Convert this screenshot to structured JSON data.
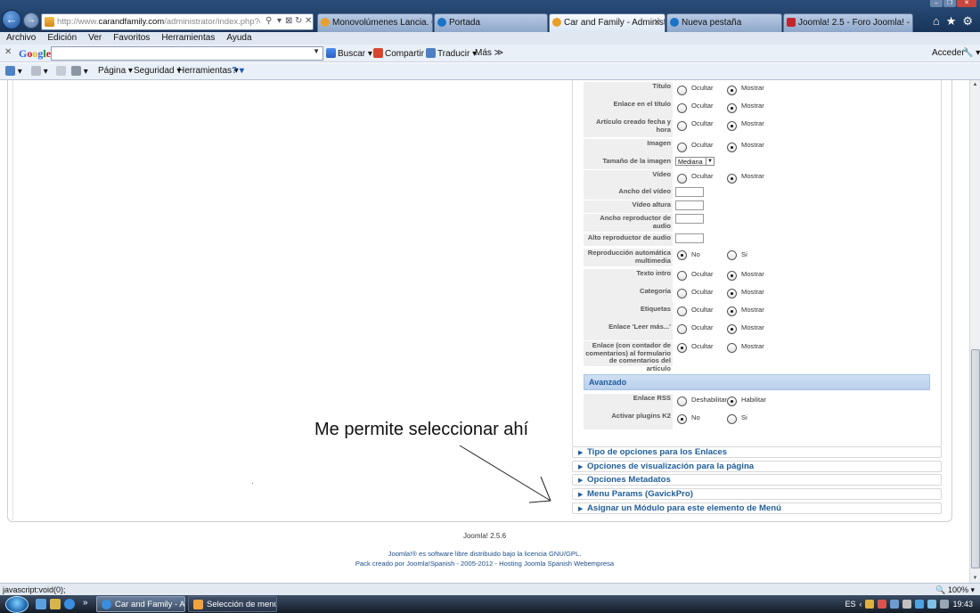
{
  "browser": {
    "url_prefix": "http://www.",
    "url_domain": "carandfamily.com",
    "url_path": "/administrator/index.php?option=co",
    "addr_controls": [
      "⚲",
      "▾",
      "⊠",
      "↻",
      "✕"
    ],
    "tabs": [
      {
        "label": "Monovolúmenes Lancia. Coch...",
        "icon_color": "#e8a02a",
        "active": false
      },
      {
        "label": "Portada",
        "icon_color": "#1a73c9",
        "active": false
      },
      {
        "label": "Car and Family - Administ...",
        "icon_color": "#e8a02a",
        "active": true
      },
      {
        "label": "Nueva pestaña",
        "icon_color": "#1a73c9",
        "active": false
      },
      {
        "label": "Joomla! 2.5 - Foro Joomla! - Se...",
        "icon_color": "#c1272d",
        "active": false
      }
    ],
    "tab_close": "✕",
    "window_buttons": [
      "–",
      "❐",
      "✕"
    ],
    "chrome_icons": {
      "home": "⌂",
      "favorites": "★",
      "tools": "⚙"
    },
    "menu": [
      "Archivo",
      "Edición",
      "Ver",
      "Favoritos",
      "Herramientas",
      "Ayuda"
    ],
    "google_bar": {
      "close": "✕",
      "logo": "Google",
      "search_value": "",
      "dropdown": "▼",
      "buscar": "Buscar ▾",
      "compartir": "Compartir",
      "traducir": "Traducir ▾",
      "mas": "Más ≫",
      "acceder": "Acceder",
      "wrench": "🔧 ▾"
    },
    "command_bar": {
      "pagina": "Página ▾",
      "seguridad": "Seguridad ▾",
      "herramientas": "Herramientas ▾",
      "help": "? ▾"
    },
    "status_text": "javascript:void(0);",
    "zoom": "🔍 100%  ▾"
  },
  "options": {
    "rows": [
      {
        "label": "Título",
        "opt1": "Ocultar",
        "opt2": "Mostrar",
        "selected": 2
      },
      {
        "label": "Enlace en el título",
        "opt1": "Ocultar",
        "opt2": "Mostrar",
        "selected": 2
      },
      {
        "label": "Artículo creado fecha y hora",
        "opt1": "Ocultar",
        "opt2": "Mostrar",
        "selected": 2
      },
      {
        "label": "Imagen",
        "opt1": "Ocultar",
        "opt2": "Mostrar",
        "selected": 2
      },
      {
        "label": "Tamaño de la imagen",
        "select_value": "Mediana"
      },
      {
        "label": "Vídeo",
        "opt1": "Ocultar",
        "opt2": "Mostrar",
        "selected": 2
      },
      {
        "label": "Ancho del vídeo",
        "input_value": ""
      },
      {
        "label": "Vídeo altura",
        "input_value": ""
      },
      {
        "label": "Ancho reproductor de audio",
        "input_value": ""
      },
      {
        "label": "Alto reproductor de audio",
        "input_value": ""
      },
      {
        "label": "Reproducción automática multimedia",
        "opt1": "No",
        "opt2": "Si",
        "selected": 1
      },
      {
        "label": "Texto intro",
        "opt1": "Ocultar",
        "opt2": "Mostrar",
        "selected": 2
      },
      {
        "label": "Categoría",
        "opt1": "Ocultar",
        "opt2": "Mostrar",
        "selected": 2
      },
      {
        "label": "Etiquetas",
        "opt1": "Ocultar",
        "opt2": "Mostrar",
        "selected": 2
      },
      {
        "label": "Enlace 'Leer más...'",
        "opt1": "Ocultar",
        "opt2": "Mostrar",
        "selected": 2
      },
      {
        "label": "Enlace (con contador de comentarios) al formulario de comentarios del artículo",
        "opt1": "Ocultar",
        "opt2": "Mostrar",
        "selected": 1
      }
    ],
    "advanced_header": "Avanzado",
    "advanced_rows": [
      {
        "label": "Enlace RSS",
        "opt1": "Deshabilitar",
        "opt2": "Habilitar",
        "selected": 2
      },
      {
        "label": "Activar plugins K2",
        "opt1": "No",
        "opt2": "Si",
        "selected": 1
      }
    ]
  },
  "accordion": [
    "Tipo de opciones para los Enlaces",
    "Opciones de visualización para la página",
    "Opciones Metadatos",
    "Menu Params (GavickPro)",
    "Asignar un Módulo para este elemento de Menú"
  ],
  "accordion_arrow": "▶",
  "annotation": "Me permite seleccionar ahí",
  "footer": {
    "version": "Joomla! 2.5.6",
    "license_link": "Joomla!®",
    "license_text": " es software libre distribuido bajo la licencia GNU/GPL.",
    "pack_text": "Pack creado por Joomla!Spanish - 2005-2012 - Hosting Joomla Spanish Webempresa"
  },
  "taskbar": {
    "tasks": [
      {
        "label": "Car and Family - Ad...",
        "active": true,
        "icon_color": "#3a8de0"
      },
      {
        "label": "Selección de menú ...",
        "active": false,
        "icon_color": "#f1a33a"
      }
    ],
    "more": "»",
    "lang": "ES",
    "tray_arrow": "‹",
    "clock": "19:43"
  },
  "colors": {
    "accent_link": "#1f5d99",
    "section_header_bg": "#c8dbf2"
  }
}
